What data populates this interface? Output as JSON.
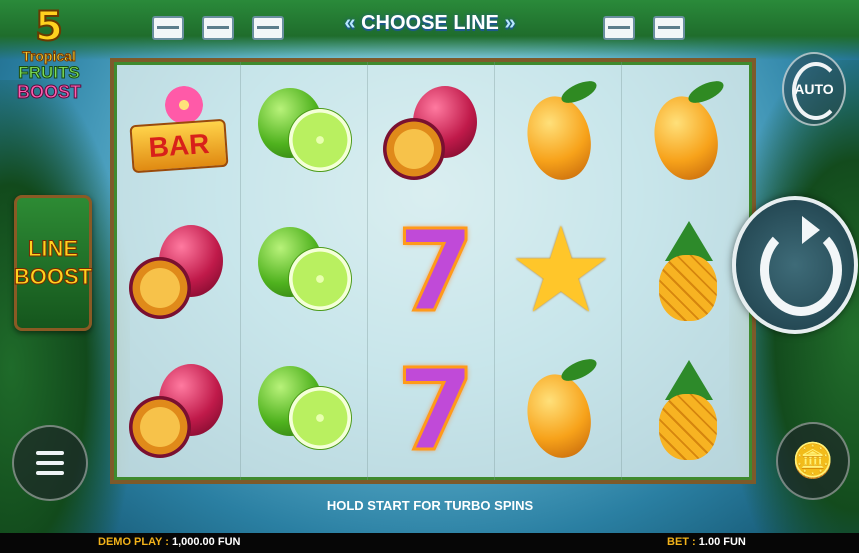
{
  "logo": {
    "number": "5",
    "word1": "Tropical",
    "word2": "FRUITS",
    "word3": "BOOST"
  },
  "line_boost": {
    "line1": "LINE",
    "line2": "BOOST"
  },
  "header": {
    "choose_line": "CHOOSE LINE",
    "arrow_left": "«",
    "arrow_right": "»"
  },
  "reels": [
    [
      "bar",
      "passion-fruit",
      "passion-fruit"
    ],
    [
      "lime",
      "lime",
      "lime"
    ],
    [
      "passion-fruit",
      "seven",
      "seven"
    ],
    [
      "mango",
      "star-fruit",
      "mango"
    ],
    [
      "mango",
      "pineapple",
      "pineapple"
    ]
  ],
  "symbols": {
    "bar_label": "BAR",
    "seven_label": "7",
    "star_glyph": "★"
  },
  "controls": {
    "auto_label": "AUTO",
    "coins_glyph": "🪙"
  },
  "message": "HOLD START FOR TURBO SPINS",
  "footer": {
    "demo_label": "DEMO PLAY :",
    "demo_value": "1,000.00 FUN",
    "bet_label": "BET :",
    "bet_value": "1.00 FUN"
  },
  "colors": {
    "accent_gold": "#f2b21a",
    "frame_wood": "#7d5a2a"
  }
}
